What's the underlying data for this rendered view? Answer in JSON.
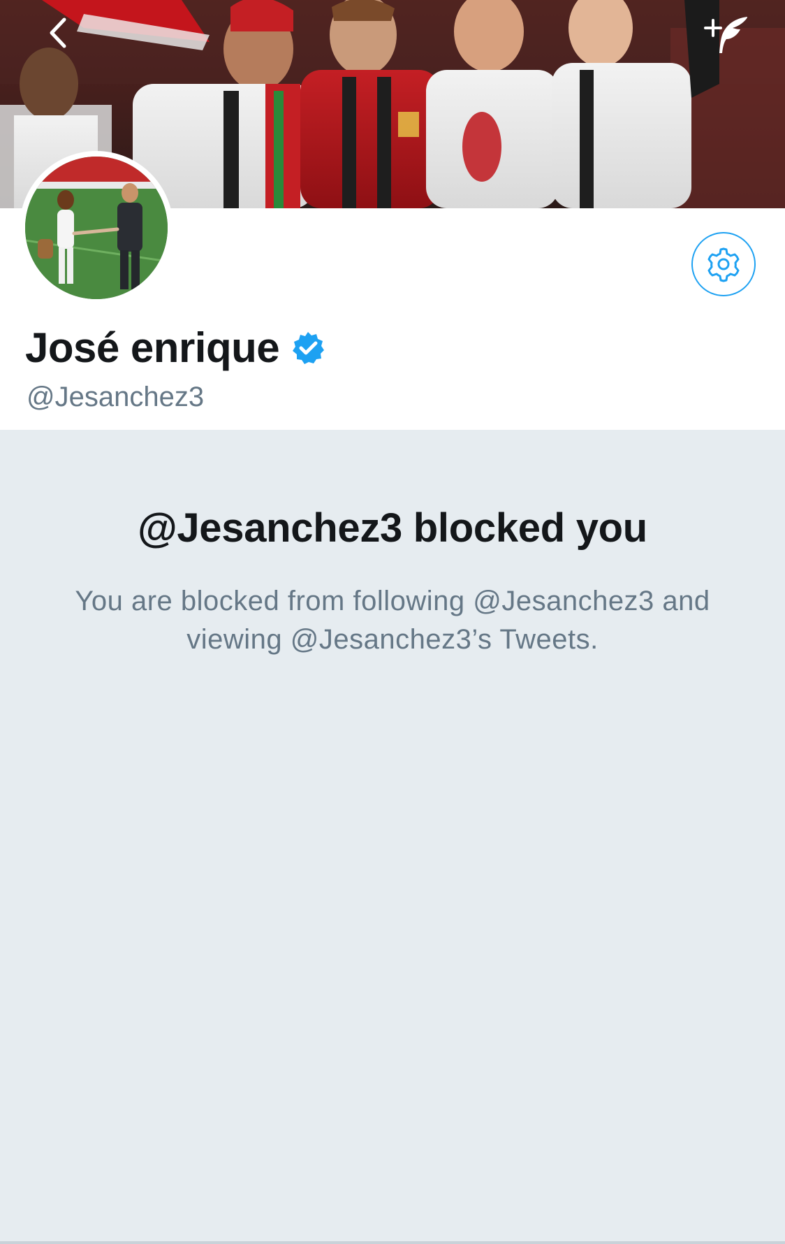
{
  "banner": {
    "back_icon": "chevron-left-icon",
    "compose_icon": "compose-tweet-icon"
  },
  "profile": {
    "display_name": "José enrique",
    "verified": true,
    "handle": "@Jesanchez3",
    "settings_icon": "gear-icon",
    "accent_color": "#1da1f2"
  },
  "blocked": {
    "title": "@Jesanchez3 blocked you",
    "message": "You are blocked from following @Jesanchez3 and viewing @Jesanchez3’s Tweets."
  },
  "colors": {
    "primary_text": "#14171a",
    "secondary_text": "#657786",
    "panel_background": "#e6ecf0",
    "verified_badge": "#1da1f2"
  }
}
